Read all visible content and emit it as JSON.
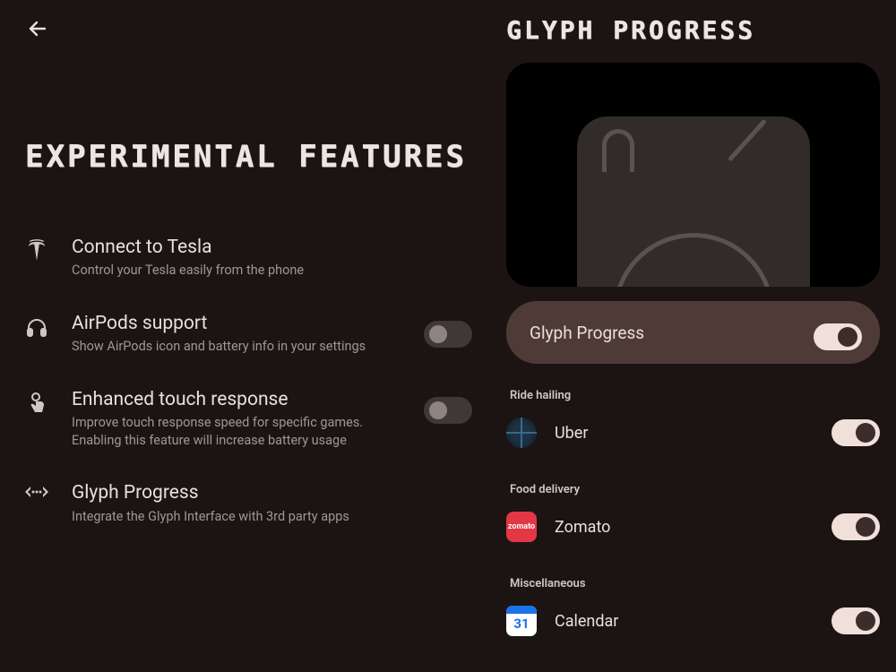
{
  "left": {
    "title": "EXPERIMENTAL FEATURES",
    "items": [
      {
        "title": "Connect to Tesla",
        "desc": "Control your Tesla easily from the phone",
        "icon": "tesla",
        "toggle": null
      },
      {
        "title": "AirPods support",
        "desc": "Show AirPods icon and battery info in your settings",
        "icon": "headphones",
        "toggle": "off"
      },
      {
        "title": "Enhanced touch response",
        "desc": "Improve touch response speed for specific games. Enabling this feature will increase battery usage",
        "icon": "touch",
        "toggle": "off"
      },
      {
        "title": "Glyph Progress",
        "desc": "Integrate the Glyph Interface with 3rd party apps",
        "icon": "integrate",
        "toggle": null
      }
    ]
  },
  "right": {
    "title": "GLYPH PROGRESS",
    "main_toggle": {
      "label": "Glyph Progress",
      "state": "on"
    },
    "sections": [
      {
        "label": "Ride hailing",
        "apps": [
          {
            "name": "Uber",
            "state": "on",
            "icon": "uber"
          }
        ]
      },
      {
        "label": "Food delivery",
        "apps": [
          {
            "name": "Zomato",
            "state": "on",
            "icon": "zomato"
          }
        ]
      },
      {
        "label": "Miscellaneous",
        "apps": [
          {
            "name": "Calendar",
            "state": "on",
            "icon": "calendar",
            "badge": "31"
          }
        ]
      }
    ]
  }
}
